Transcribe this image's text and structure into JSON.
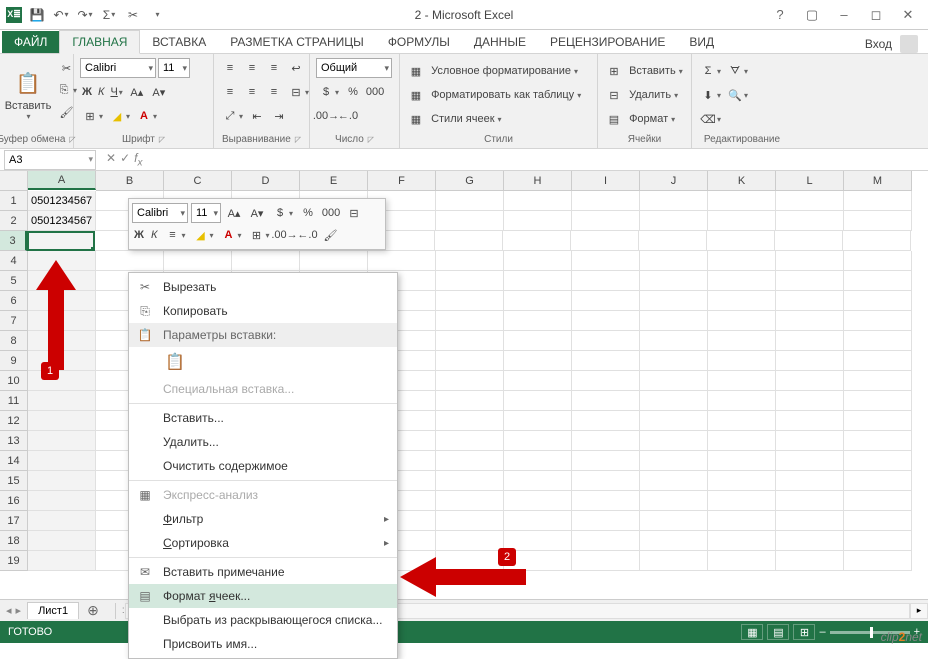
{
  "title": "2 - Microsoft Excel",
  "tabs": {
    "file": "ФАЙЛ",
    "home": "ГЛАВНАЯ",
    "insert": "ВСТАВКА",
    "layout": "РАЗМЕТКА СТРАНИЦЫ",
    "formulas": "ФОРМУЛЫ",
    "data": "ДАННЫЕ",
    "review": "РЕЦЕНЗИРОВАНИЕ",
    "view": "ВИД",
    "login": "Вход"
  },
  "ribbon": {
    "clipboard": {
      "paste": "Вставить",
      "group": "Буфер обмена"
    },
    "font": {
      "family": "Calibri",
      "size": "11",
      "bold": "Ж",
      "italic": "К",
      "underline": "Ч",
      "group": "Шрифт"
    },
    "align": {
      "group": "Выравнивание"
    },
    "number": {
      "format": "Общий",
      "group": "Число"
    },
    "styles": {
      "cond": "Условное форматирование",
      "table": "Форматировать как таблицу",
      "cell": "Стили ячеек",
      "group": "Стили"
    },
    "cells": {
      "insert": "Вставить",
      "delete": "Удалить",
      "format": "Формат",
      "group": "Ячейки"
    },
    "editing": {
      "group": "Редактирование"
    }
  },
  "namebox": "A3",
  "fx": "",
  "columns": [
    "A",
    "B",
    "C",
    "D",
    "E",
    "F",
    "G",
    "H",
    "I",
    "J",
    "K",
    "L",
    "M"
  ],
  "rows": [
    "1",
    "2",
    "3",
    "4",
    "5",
    "6",
    "7",
    "8",
    "9",
    "10",
    "11",
    "12",
    "13",
    "14",
    "15",
    "16",
    "17",
    "18",
    "19"
  ],
  "cells": {
    "A1": "0501234567",
    "A2": "0501234567"
  },
  "mini": {
    "font": "Calibri",
    "size": "11",
    "bold": "Ж",
    "italic": "К"
  },
  "ctx": {
    "cut": "Вырезать",
    "copy": "Копировать",
    "paste_opts": "Параметры вставки:",
    "paste_special": "Специальная вставка...",
    "insert": "Вставить...",
    "delete": "Удалить...",
    "clear": "Очистить содержимое",
    "quick": "Экспресс-анализ",
    "filter": "Фильтр",
    "sort": "Сортировка",
    "comment": "Вставить примечание",
    "format_cells": "Формат ячеек...",
    "dropdown": "Выбрать из раскрывающегося списка...",
    "name": "Присвоить имя..."
  },
  "sheet": {
    "tab1": "Лист1"
  },
  "status": {
    "ready": "ГОТОВО",
    "zoom": "100%"
  },
  "callout1": "1",
  "callout2": "2",
  "watermark1": "clip",
  "watermark2": "2",
  "watermark3": "net"
}
